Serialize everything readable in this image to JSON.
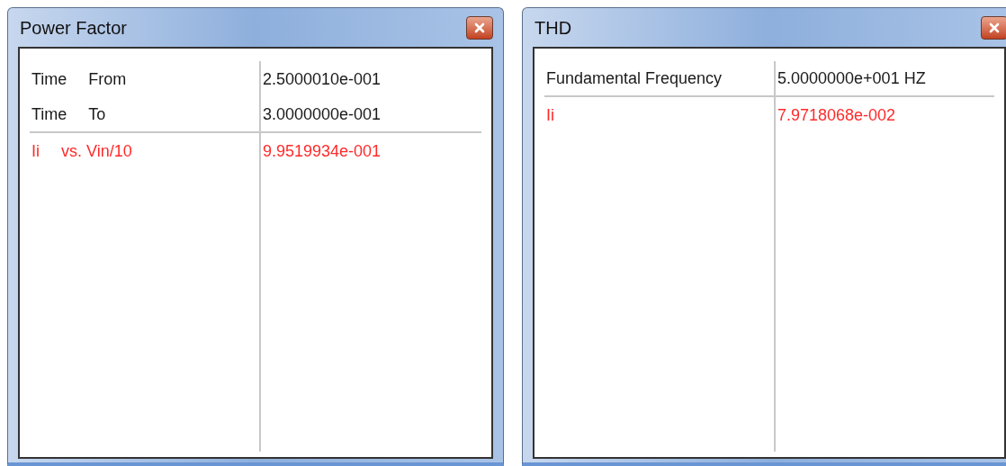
{
  "windows": [
    {
      "title": "Power Factor",
      "rows": [
        {
          "label": [
            "Time",
            "From"
          ],
          "value": "2.5000010e-001",
          "color": "#1a1a1a",
          "separator_below": false
        },
        {
          "label": [
            "Time",
            "To"
          ],
          "value": "3.0000000e-001",
          "color": "#1a1a1a",
          "separator_below": true
        },
        {
          "label": [
            "Ii",
            "vs. Vin/10"
          ],
          "value": "9.9519934e-001",
          "color": "#ff2a2a",
          "separator_below": false
        }
      ]
    },
    {
      "title": "THD",
      "rows": [
        {
          "label": [
            "Fundamental Frequency"
          ],
          "value": "5.0000000e+001 HZ",
          "color": "#1a1a1a",
          "separator_below": true
        },
        {
          "label": [
            "Ii"
          ],
          "value": "7.9718068e-002",
          "color": "#ff2a2a",
          "separator_below": false
        }
      ]
    }
  ]
}
